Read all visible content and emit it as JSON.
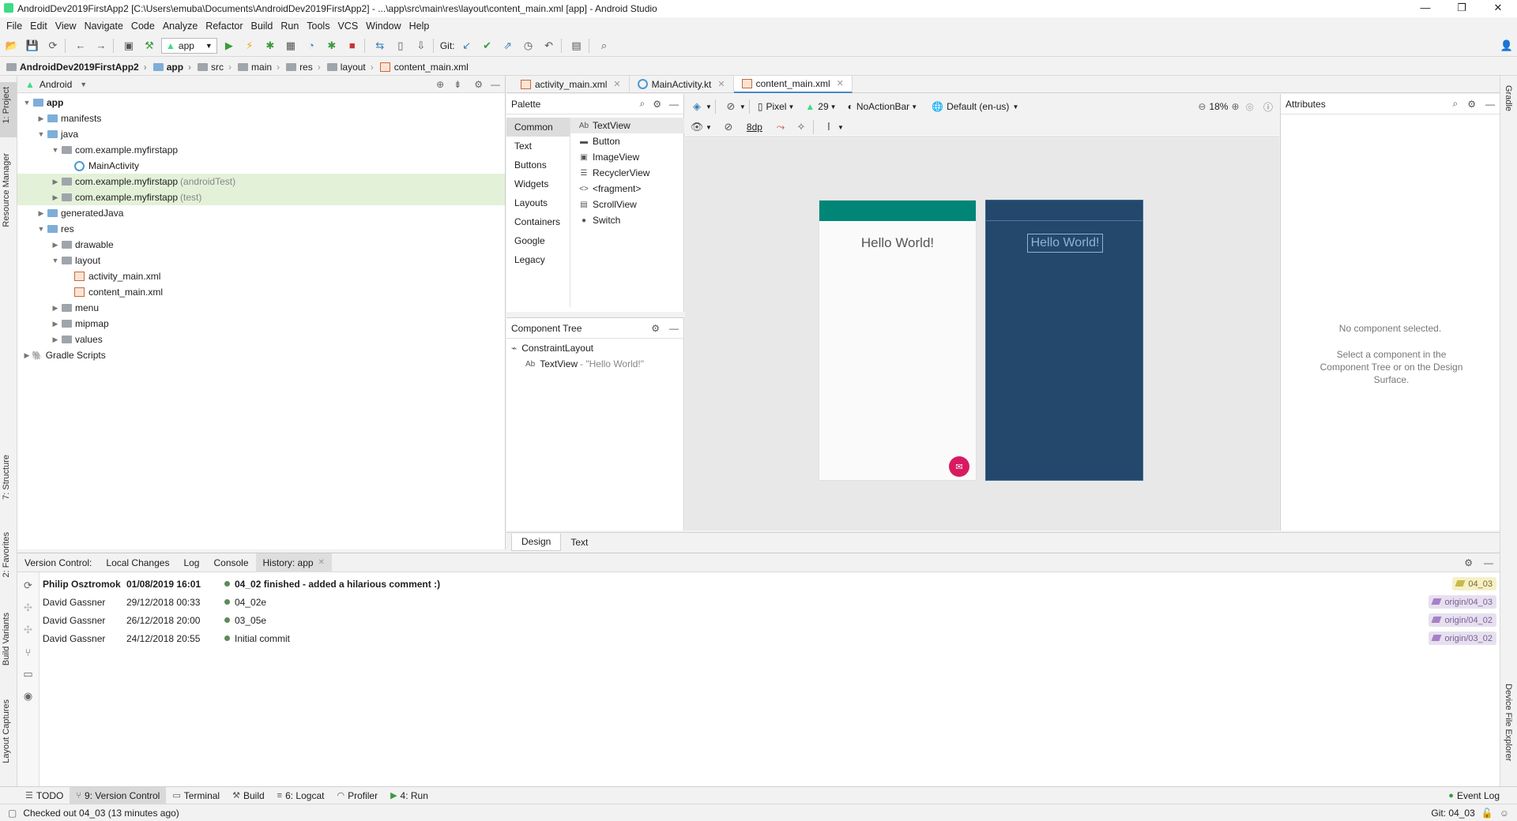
{
  "window": {
    "title": "AndroidDev2019FirstApp2 [C:\\Users\\emuba\\Documents\\AndroidDev2019FirstApp2] - ...\\app\\src\\main\\res\\layout\\content_main.xml [app] - Android Studio",
    "minimize": "—",
    "maximize": "❐",
    "close": "✕"
  },
  "menu": [
    "File",
    "Edit",
    "View",
    "Navigate",
    "Code",
    "Analyze",
    "Refactor",
    "Build",
    "Run",
    "Tools",
    "VCS",
    "Window",
    "Help"
  ],
  "toolbar": {
    "run_config": "app",
    "git_label": "Git:"
  },
  "breadcrumb": [
    "AndroidDev2019FirstApp2",
    "app",
    "src",
    "main",
    "res",
    "layout",
    "content_main.xml"
  ],
  "left_stripe": {
    "project": "1: Project",
    "resource_manager": "Resource Manager",
    "structure": "7: Structure",
    "favorites": "2: Favorites",
    "build_variants": "Build Variants",
    "layout_captures": "Layout Captures"
  },
  "right_stripe": {
    "gradle": "Gradle",
    "device_explorer": "Device File Explorer"
  },
  "project": {
    "view_mode": "Android",
    "tree": [
      {
        "label": "app",
        "depth": 0,
        "icon": "folder-blue",
        "expanded": true,
        "bold": true
      },
      {
        "label": "manifests",
        "depth": 1,
        "icon": "folder-blue",
        "expanded": false
      },
      {
        "label": "java",
        "depth": 1,
        "icon": "folder-blue",
        "expanded": true
      },
      {
        "label": "com.example.myfirstapp",
        "depth": 2,
        "icon": "package",
        "expanded": true
      },
      {
        "label": "MainActivity",
        "depth": 3,
        "icon": "kotlin-class"
      },
      {
        "label": "com.example.myfirstapp",
        "suffix": "(androidTest)",
        "depth": 2,
        "icon": "package",
        "expanded": false,
        "highlight": true
      },
      {
        "label": "com.example.myfirstapp",
        "suffix": "(test)",
        "depth": 2,
        "icon": "package",
        "expanded": false,
        "highlight": true
      },
      {
        "label": "generatedJava",
        "depth": 1,
        "icon": "folder-blue",
        "expanded": false
      },
      {
        "label": "res",
        "depth": 1,
        "icon": "folder-blue",
        "expanded": true
      },
      {
        "label": "drawable",
        "depth": 2,
        "icon": "folder",
        "expanded": false
      },
      {
        "label": "layout",
        "depth": 2,
        "icon": "folder",
        "expanded": true
      },
      {
        "label": "activity_main.xml",
        "depth": 3,
        "icon": "xml"
      },
      {
        "label": "content_main.xml",
        "depth": 3,
        "icon": "xml"
      },
      {
        "label": "menu",
        "depth": 2,
        "icon": "folder",
        "expanded": false
      },
      {
        "label": "mipmap",
        "depth": 2,
        "icon": "folder",
        "expanded": false
      },
      {
        "label": "values",
        "depth": 2,
        "icon": "folder",
        "expanded": false
      },
      {
        "label": "Gradle Scripts",
        "depth": 0,
        "icon": "gradle",
        "expanded": false
      }
    ]
  },
  "editor_tabs": [
    {
      "label": "activity_main.xml",
      "icon": "xml",
      "active": false
    },
    {
      "label": "MainActivity.kt",
      "icon": "kotlin",
      "active": false
    },
    {
      "label": "content_main.xml",
      "icon": "xml",
      "active": true
    }
  ],
  "palette": {
    "title": "Palette",
    "categories": [
      "Common",
      "Text",
      "Buttons",
      "Widgets",
      "Layouts",
      "Containers",
      "Google",
      "Legacy"
    ],
    "selected_category": "Common",
    "items": [
      {
        "label": "TextView",
        "icon": "Ab"
      },
      {
        "label": "Button",
        "icon": "▬"
      },
      {
        "label": "ImageView",
        "icon": "▣"
      },
      {
        "label": "RecyclerView",
        "icon": "☰"
      },
      {
        "label": "<fragment>",
        "icon": "<>"
      },
      {
        "label": "ScrollView",
        "icon": "▤"
      },
      {
        "label": "Switch",
        "icon": "●"
      }
    ]
  },
  "component_tree": {
    "title": "Component Tree",
    "root": "ConstraintLayout",
    "child_icon": "Ab",
    "child_label": "TextView",
    "child_text": "- \"Hello World!\""
  },
  "design_toolbar": {
    "device": "Pixel",
    "api": "29",
    "theme": "NoActionBar",
    "locale": "Default (en-us)",
    "zoom": "18%",
    "margin": "8dp"
  },
  "design_surface": {
    "hello_text": "Hello World!",
    "blueprint_text": "Hello World!",
    "toolbar_color": "#008577",
    "fab_color": "#D81B60",
    "blueprint_color": "#23486C"
  },
  "attributes": {
    "title": "Attributes",
    "empty_title": "No component selected.",
    "empty_hint": "Select a component in the Component Tree or on the Design Surface."
  },
  "editor_mode_tabs": [
    {
      "label": "Design",
      "active": true
    },
    {
      "label": "Text",
      "active": false
    }
  ],
  "version_control": {
    "tabs": [
      {
        "label": "Version Control:",
        "active": false
      },
      {
        "label": "Local Changes",
        "active": false
      },
      {
        "label": "Log",
        "active": false
      },
      {
        "label": "Console",
        "active": false
      },
      {
        "label": "History: app",
        "active": true,
        "closable": true
      }
    ],
    "commits": [
      {
        "author": "Philip Osztromok",
        "date": "01/08/2019 16:01",
        "message": "04_02 finished - added a hilarious comment :)",
        "bold": true,
        "tag": "04_03",
        "current": true
      },
      {
        "author": "David Gassner",
        "date": "29/12/2018 00:33",
        "message": "04_02e",
        "bold": false,
        "tag": "origin/04_03",
        "current": false
      },
      {
        "author": "David Gassner",
        "date": "26/12/2018 20:00",
        "message": "03_05e",
        "bold": false,
        "tag": "origin/04_02",
        "current": false
      },
      {
        "author": "David Gassner",
        "date": "24/12/2018 20:55",
        "message": "Initial commit",
        "bold": false,
        "tag": "origin/03_02",
        "current": false
      }
    ]
  },
  "tool_windows": [
    {
      "label": "TODO",
      "icon": "☰",
      "active": false
    },
    {
      "label": "9: Version Control",
      "icon": "⑂",
      "active": true
    },
    {
      "label": "Terminal",
      "icon": "▭",
      "active": false
    },
    {
      "label": "Build",
      "icon": "⚒",
      "active": false
    },
    {
      "label": "6: Logcat",
      "icon": "≡",
      "active": false
    },
    {
      "label": "Profiler",
      "icon": "◠",
      "active": false
    },
    {
      "label": "4: Run",
      "icon": "▶",
      "active": false
    }
  ],
  "event_log": "Event Log",
  "status": {
    "message": "Checked out 04_03 (13 minutes ago)",
    "git_branch": "Git: 04_03"
  }
}
